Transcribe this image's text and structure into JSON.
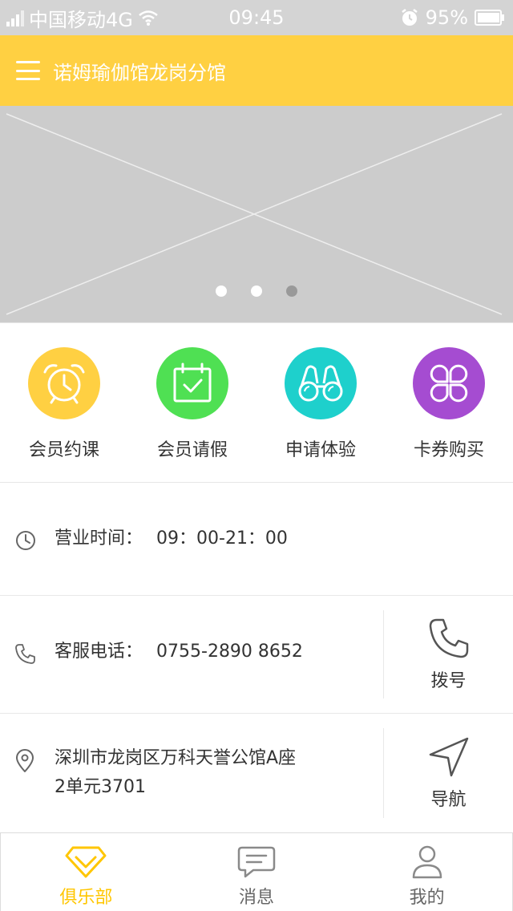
{
  "status_bar": {
    "carrier": "中国移动4G",
    "time": "09:45",
    "battery": "95%",
    "icons": [
      "signal-icon",
      "wifi-icon",
      "alarm-icon",
      "battery-icon"
    ]
  },
  "header": {
    "title": "诺姆瑜伽馆龙岗分馆",
    "menu_icon": "menu-icon",
    "background": "#ffd042"
  },
  "banner": {
    "slide_count": 3,
    "active_slide": 3
  },
  "quick_actions": [
    {
      "label": "会员约课",
      "icon": "alarm-clock-icon",
      "color": "#ffd042"
    },
    {
      "label": "会员请假",
      "icon": "calendar-check-icon",
      "color": "#4fe053"
    },
    {
      "label": "申请体验",
      "icon": "binoculars-icon",
      "color": "#1ed0cc"
    },
    {
      "label": "卡券购买",
      "icon": "clover-icon",
      "color": "#a54cd1"
    }
  ],
  "info": {
    "hours": {
      "label": "营业时间：",
      "value": "09：00-21：00"
    },
    "phone": {
      "label": "客服电话：",
      "value": "0755-2890 8652",
      "action": "拨号"
    },
    "address": {
      "line1": "深圳市龙岗区万科天誉公馆A座",
      "line2": "2单元3701",
      "action": "导航"
    }
  },
  "tabbar": {
    "tabs": [
      {
        "label": "俱乐部",
        "icon": "diamond-icon",
        "active": true
      },
      {
        "label": "消息",
        "icon": "chat-icon",
        "active": false
      },
      {
        "label": "我的",
        "icon": "user-icon",
        "active": false
      }
    ],
    "active_color": "#ffc600"
  }
}
